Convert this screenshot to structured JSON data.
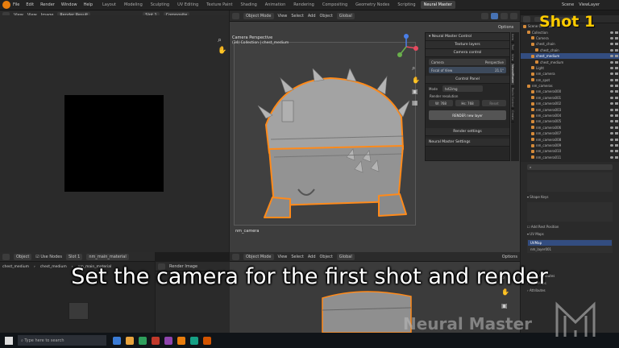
{
  "app": {
    "menu": [
      "File",
      "Edit",
      "Render",
      "Window",
      "Help"
    ],
    "workspaces": [
      "Layout",
      "Modeling",
      "Sculpting",
      "UV Editing",
      "Texture Paint",
      "Shading",
      "Animation",
      "Rendering",
      "Compositing",
      "Geometry Nodes",
      "Scripting",
      "Neural Master"
    ],
    "active_workspace": "Neural Master",
    "scene": "Scene",
    "view_layer": "ViewLayer"
  },
  "image_editor": {
    "menu": [
      "View",
      "View",
      "Image"
    ],
    "image": "Render Result",
    "slot": "Slot 1",
    "layer": "Composite"
  },
  "viewport": {
    "mode": "Object Mode",
    "menu": [
      "View",
      "Select",
      "Add",
      "Object"
    ],
    "orientation": "Global",
    "title": "Camera Perspective",
    "subtitle": "(34) Collection | chest_medium",
    "camera_label": "nm_camera",
    "options": "Options"
  },
  "npanel": {
    "header": "Neural Master Control",
    "texture_layers": "Texture layers",
    "camera_control": "Camera control",
    "camera_type_label": "Camera",
    "camera_type_value": "Perspective",
    "focal_label": "Focal of View",
    "focal_value": "21.1°",
    "control_panel": "Control Panel",
    "mode_label": "Mode",
    "mode_value": "txt2img",
    "render_resolution": "Render resolution",
    "res_w": "W: 768",
    "res_h": "Hs: 768",
    "reset": "Reset",
    "render_button": "RENDER new layer",
    "render_settings": "Render settings",
    "settings": "Neural Master Settings",
    "tabs": [
      "Item",
      "Tool",
      "View",
      "NeuralMaster",
      "Rodin Control",
      "Create"
    ]
  },
  "outliner": {
    "items": [
      {
        "label": "Scene Collection",
        "indent": 0,
        "sel": false
      },
      {
        "label": "Collection",
        "indent": 1,
        "sel": false
      },
      {
        "label": "Camera",
        "indent": 2,
        "sel": false
      },
      {
        "label": "chest_chain",
        "indent": 2,
        "sel": false
      },
      {
        "label": "chest_chain",
        "indent": 3,
        "sel": false
      },
      {
        "label": "chest_medium",
        "indent": 2,
        "sel": true
      },
      {
        "label": "chest_medium",
        "indent": 3,
        "sel": false
      },
      {
        "label": "Light",
        "indent": 2,
        "sel": false
      },
      {
        "label": "nm_camera",
        "indent": 2,
        "sel": false
      },
      {
        "label": "nm_spot",
        "indent": 2,
        "sel": false
      },
      {
        "label": "nm_cameras",
        "indent": 1,
        "sel": false
      },
      {
        "label": "nm_camera000",
        "indent": 2,
        "sel": false
      },
      {
        "label": "nm_camera001",
        "indent": 2,
        "sel": false
      },
      {
        "label": "nm_camera002",
        "indent": 2,
        "sel": false
      },
      {
        "label": "nm_camera003",
        "indent": 2,
        "sel": false
      },
      {
        "label": "nm_camera004",
        "indent": 2,
        "sel": false
      },
      {
        "label": "nm_camera005",
        "indent": 2,
        "sel": false
      },
      {
        "label": "nm_camera006",
        "indent": 2,
        "sel": false
      },
      {
        "label": "nm_camera007",
        "indent": 2,
        "sel": false
      },
      {
        "label": "nm_camera008",
        "indent": 2,
        "sel": false
      },
      {
        "label": "nm_camera009",
        "indent": 2,
        "sel": false
      },
      {
        "label": "nm_camera010",
        "indent": 2,
        "sel": false
      },
      {
        "label": "nm_camera011",
        "indent": 2,
        "sel": false
      }
    ]
  },
  "properties": {
    "shape_keys": "Shape Keys",
    "add_rest_position": "Add Rest Position",
    "uv_maps": "UV Maps",
    "uv_items": [
      "UVMap",
      "nm_layer001"
    ],
    "color_attributes": "Color Attributes",
    "face_maps": "Face Maps",
    "attributes": "Attributes"
  },
  "lower": {
    "left_mode": "Object",
    "use_nodes": "Use Nodes",
    "slot": "Slot 1",
    "material": "nm_main_material",
    "breadcrumb": [
      "chest_medium",
      "chest_medium",
      "nm_main_material"
    ],
    "mid_header": "Render Image",
    "right_mode": "Object Mode",
    "right_menu": [
      "View",
      "Select",
      "Add",
      "Object"
    ],
    "right_orientation": "Global",
    "right_options": "Options"
  },
  "overlay": {
    "shot": "Shot 1",
    "caption": "Set the camera for the first shot and render",
    "brand": "Neural Master"
  },
  "taskbar": {
    "search_placeholder": "Type here to search"
  }
}
